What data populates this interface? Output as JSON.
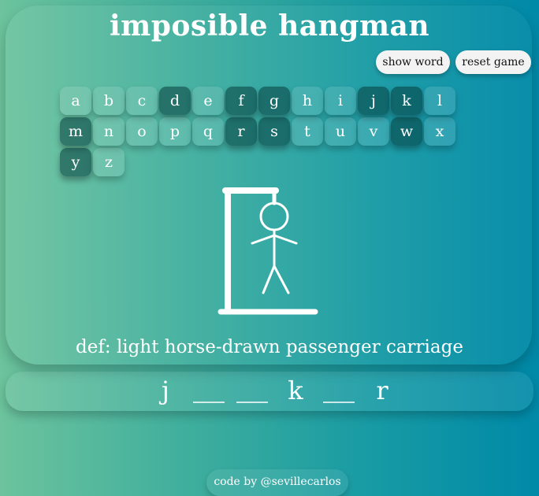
{
  "app": {
    "title": "imposible hangman"
  },
  "controls": {
    "show_word": "show word",
    "reset_game": "reset game"
  },
  "keyboard": {
    "keys": [
      {
        "letter": "a",
        "used": false
      },
      {
        "letter": "b",
        "used": false
      },
      {
        "letter": "c",
        "used": false
      },
      {
        "letter": "d",
        "used": true
      },
      {
        "letter": "e",
        "used": false
      },
      {
        "letter": "f",
        "used": true
      },
      {
        "letter": "g",
        "used": true
      },
      {
        "letter": "h",
        "used": false
      },
      {
        "letter": "i",
        "used": false
      },
      {
        "letter": "j",
        "used": true
      },
      {
        "letter": "k",
        "used": true
      },
      {
        "letter": "l",
        "used": false
      },
      {
        "letter": "m",
        "used": true
      },
      {
        "letter": "n",
        "used": false
      },
      {
        "letter": "o",
        "used": false
      },
      {
        "letter": "p",
        "used": false
      },
      {
        "letter": "q",
        "used": false
      },
      {
        "letter": "r",
        "used": true
      },
      {
        "letter": "s",
        "used": true
      },
      {
        "letter": "t",
        "used": false
      },
      {
        "letter": "u",
        "used": false
      },
      {
        "letter": "v",
        "used": false
      },
      {
        "letter": "w",
        "used": true
      },
      {
        "letter": "x",
        "used": false
      },
      {
        "letter": "y",
        "used": true
      },
      {
        "letter": "z",
        "used": false
      }
    ]
  },
  "hangman": {
    "icon": "hangman-figure-icon",
    "stage": "complete"
  },
  "definition": "def: light horse-drawn passenger carriage",
  "word": {
    "slots": [
      "j",
      "",
      "",
      "k",
      "",
      "r"
    ]
  },
  "footer": {
    "credit": "code by @sevillecarlos"
  }
}
